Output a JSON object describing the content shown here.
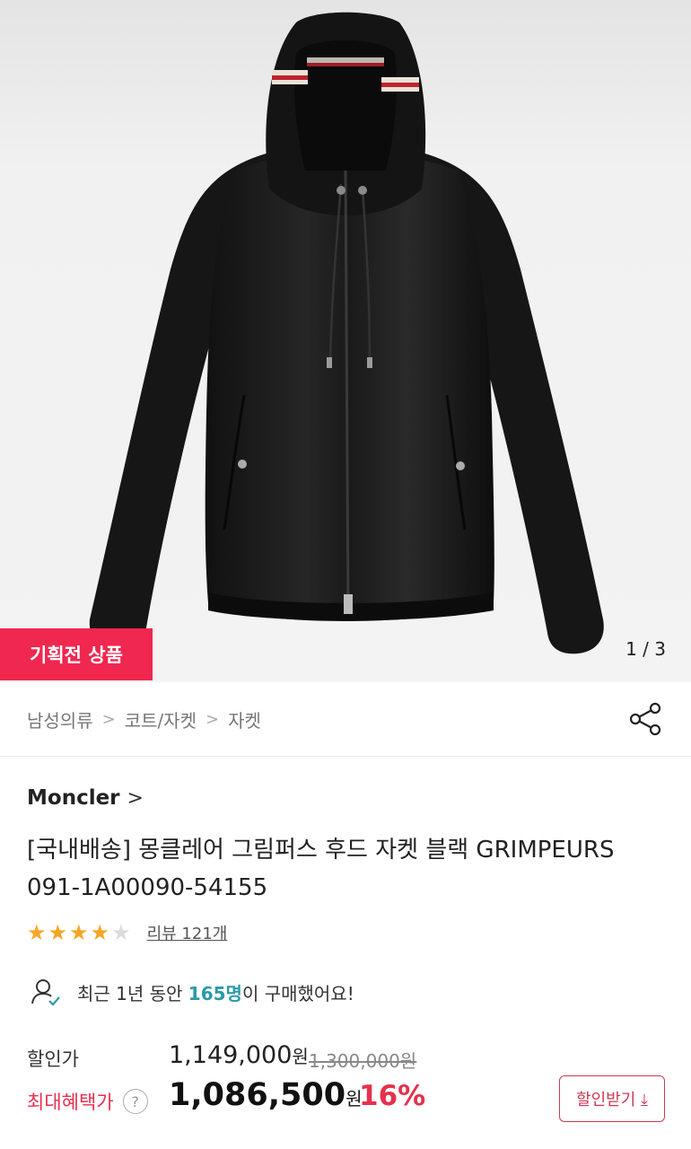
{
  "product_image": {
    "badge": "기획전 상품",
    "counter": "1 / 3"
  },
  "breadcrumb": [
    "남성의류",
    "코트/자켓",
    "자켓"
  ],
  "brand": "Moncler",
  "title_line1": "[국내배송] 몽클레어 그림퍼스 후드 자켓 블랙 GRIMPEURS",
  "title_line2": "091-1A00090-54155",
  "rating": {
    "stars": 4,
    "max": 5,
    "review_label": "리뷰 121개"
  },
  "buyers": {
    "prefix": "최근 1년 동안 ",
    "count": "165명",
    "suffix": "이 구매했어요!"
  },
  "price": {
    "sale_label": "할인가",
    "sale_amount": "1,149,000",
    "won": "원",
    "original": "1,300,000원",
    "max_label": "최대혜택가",
    "help": "?",
    "final_amount": "1,086,500",
    "discount": "16%",
    "coupon_button": "할인받기 ⤓"
  },
  "colors": {
    "badge": "#f0274f",
    "accent_red": "#e6304d",
    "buyer_count": "#2b9aa8",
    "star": "#f6a623"
  }
}
